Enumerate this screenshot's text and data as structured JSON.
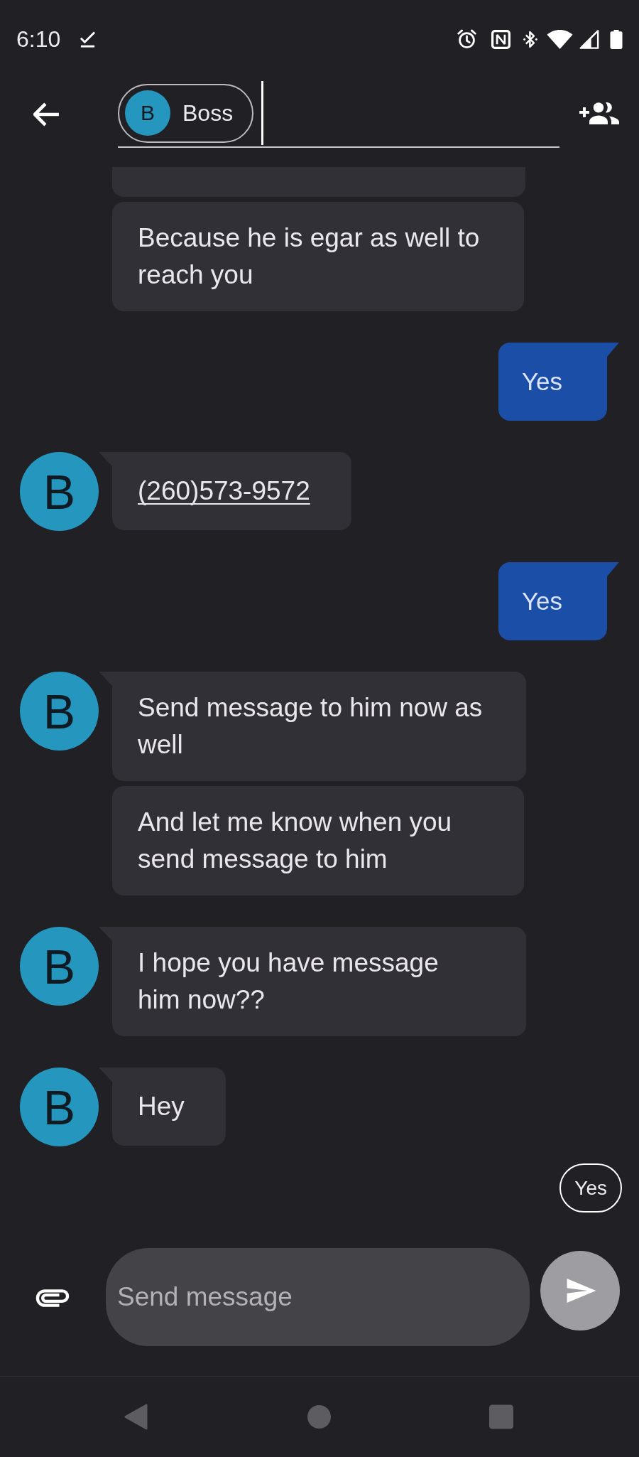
{
  "status_bar": {
    "time": "6:10"
  },
  "recipient_field": {
    "recipients": [
      {
        "initial": "B",
        "name": "Boss"
      }
    ],
    "focused": true
  },
  "messages": [
    {
      "kind": "incoming",
      "bubbles": [
        {
          "kind": "clipped"
        },
        {
          "kind": "text",
          "text": "Because he is egar as well to reach you"
        }
      ]
    },
    {
      "kind": "outgoing",
      "bubbles": [
        {
          "kind": "text",
          "text": "Yes"
        }
      ]
    },
    {
      "kind": "incoming",
      "avatar": "B",
      "bubbles": [
        {
          "kind": "link",
          "text": "(260)573-9572"
        }
      ]
    },
    {
      "kind": "outgoing",
      "bubbles": [
        {
          "kind": "text",
          "text": "Yes"
        }
      ]
    },
    {
      "kind": "incoming",
      "avatar": "B",
      "bubbles": [
        {
          "kind": "text",
          "text": "Send message to him now as well"
        },
        {
          "kind": "text",
          "text": "And let me know when you send message to him"
        }
      ]
    },
    {
      "kind": "incoming",
      "avatar": "B",
      "bubbles": [
        {
          "kind": "text",
          "text": "I hope you have message him now??"
        }
      ]
    },
    {
      "kind": "incoming",
      "avatar": "B",
      "bubbles": [
        {
          "kind": "text",
          "text": "Hey"
        }
      ]
    }
  ],
  "suggestions": [
    "Yes"
  ],
  "compose": {
    "placeholder": "Send message"
  },
  "send_button": {
    "disabled": true
  }
}
